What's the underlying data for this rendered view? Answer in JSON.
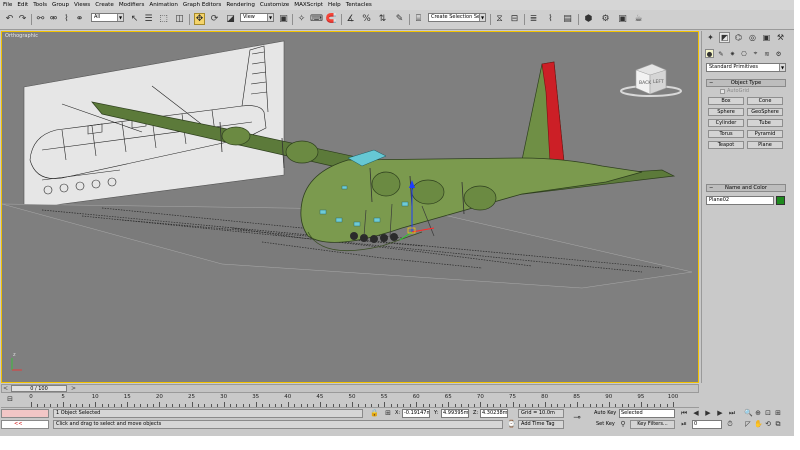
{
  "menu": [
    "File",
    "Edit",
    "Tools",
    "Group",
    "Views",
    "Create",
    "Modifiers",
    "Animation",
    "Graph Editors",
    "Rendering",
    "Customize",
    "MAXScript",
    "Help",
    "Tentacles"
  ],
  "toolbar": {
    "selection_filter": "All",
    "reference_coord": "View",
    "named_selection_placeholder": "Create Selection Se"
  },
  "viewport": {
    "label": "Orthographic",
    "viewcube_left": "BACK",
    "viewcube_right": "LEFT"
  },
  "command_panel": {
    "category_dropdown": "Standard Primitives",
    "object_type_header": "Object Type",
    "autogrid_label": "AutoGrid",
    "primitives": [
      "Box",
      "Cone",
      "Sphere",
      "GeoSphere",
      "Cylinder",
      "Tube",
      "Torus",
      "Pyramid",
      "Teapot",
      "Plane"
    ],
    "name_color_header": "Name and Color",
    "object_name": "Plane02",
    "object_color": "#1e8a1e"
  },
  "time_slider": {
    "label": "0 / 100",
    "prev": "<",
    "next": ">"
  },
  "trackbar": {
    "ticks": [
      "0",
      "5",
      "10",
      "15",
      "20",
      "25",
      "30",
      "35",
      "40",
      "45",
      "50",
      "55",
      "60",
      "65",
      "70",
      "75",
      "80",
      "85",
      "90",
      "95",
      "100"
    ]
  },
  "status": {
    "selection_count": "1 Object Selected",
    "prompt": "Click and drag to select and move objects",
    "maxscript_listener": "<<",
    "x_label": "X:",
    "x_value": "-0.19147m",
    "y_label": "Y:",
    "y_value": "4.99395m",
    "z_label": "Z:",
    "z_value": "4.30238m",
    "grid": "Grid = 10.0m",
    "add_time_tag": "Add Time Tag",
    "auto_key": "Auto Key",
    "key_mode": "Selected",
    "set_key": "Set Key",
    "key_filters": "Key Filters...",
    "current_frame": "0"
  }
}
